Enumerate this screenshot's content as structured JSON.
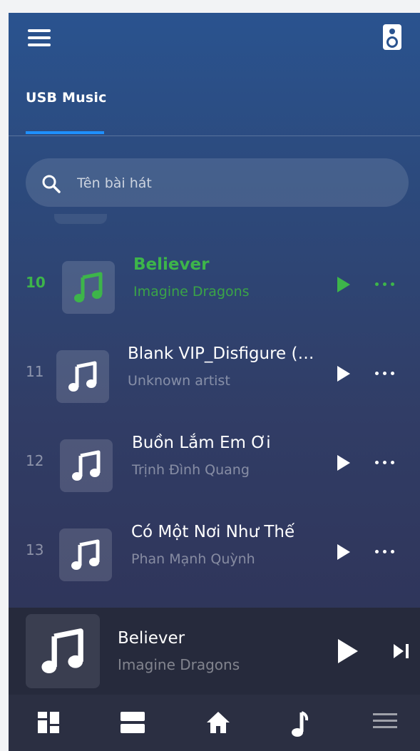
{
  "header": {
    "menu_icon": "hamburger-menu-icon",
    "speaker_icon": "speaker-icon"
  },
  "tabs": [
    {
      "label": "USB Music",
      "active": true
    }
  ],
  "search": {
    "placeholder": "Tên bài hát",
    "value": "",
    "icon": "search-icon"
  },
  "songs": [
    {
      "number": "10",
      "title": "Believer",
      "artist": "Imagine Dragons",
      "active": true
    },
    {
      "number": "11",
      "title": "Blank VIP_Disfigure (…",
      "artist": "Unknown artist",
      "active": false
    },
    {
      "number": "12",
      "title": "Buồn Lắm Em Ơi",
      "artist": "Trịnh Đình Quang",
      "active": false
    },
    {
      "number": "13",
      "title": "Có Một Nơi Như Thế",
      "artist": "Phan Mạnh Quỳnh",
      "active": false
    }
  ],
  "now_playing": {
    "title": "Believer",
    "artist": "Imagine Dragons"
  },
  "bottom_nav": [
    {
      "icon": "dashboard-grid-icon"
    },
    {
      "icon": "list-view-icon"
    },
    {
      "icon": "home-icon"
    },
    {
      "icon": "music-note-icon",
      "active": true
    },
    {
      "icon": "menu-lines-icon"
    }
  ],
  "colors": {
    "accent_green": "#3db54a",
    "tab_indicator": "#1e90ff",
    "background_top": "#2a538f",
    "background_bottom": "#2f355a"
  }
}
